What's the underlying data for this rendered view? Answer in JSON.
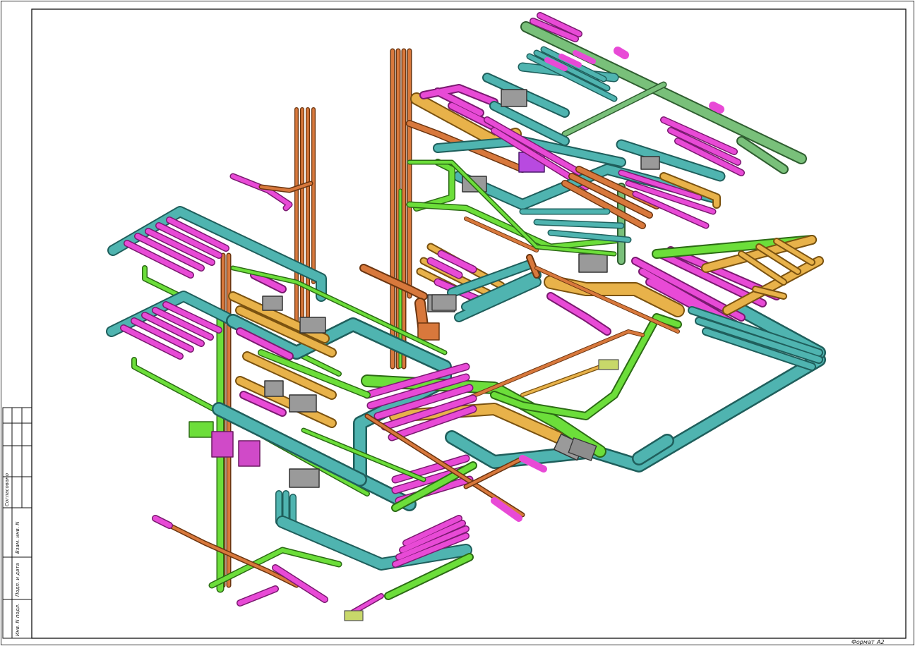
{
  "drawing": {
    "stamp": {
      "label_agreed": "Согласовано",
      "label_replaced": "Взам. инв. N",
      "label_sign": "Подп. и дата",
      "label_inv": "Инв. N подл."
    },
    "format_label": "Формат",
    "format_value": "А2"
  },
  "colors": {
    "teal": "#4fb4b0",
    "teal_edge": "#1f5f5c",
    "magenta": "#e84ad6",
    "magenta_edge": "#7a1a70",
    "green": "#6cde3a",
    "green_edge": "#2c6b15",
    "orange": "#e8b24a",
    "orange_edge": "#7a5210",
    "rust": "#d8783c",
    "rust_edge": "#6b3510",
    "sage": "#79c07a",
    "sage_edge": "#2f5e30",
    "gray_box": "#9a9a9a",
    "purple": "#b84ae0"
  }
}
